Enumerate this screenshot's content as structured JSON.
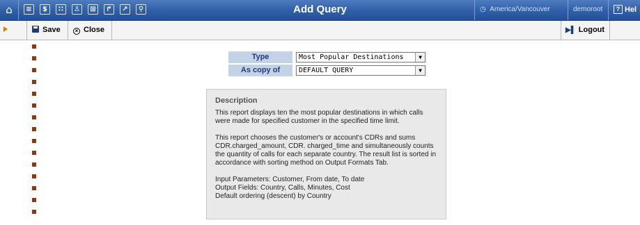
{
  "header": {
    "title": "Add Query",
    "timezone": "America/Vancouver",
    "user": "demoroot",
    "help_label": "Hel",
    "icons": [
      "home-icon",
      "list-icon",
      "dollar-icon",
      "grid-icon",
      "person-icon",
      "tree-icon",
      "arrow-icon",
      "chart-icon",
      "search-icon"
    ]
  },
  "toolbar": {
    "save_label": "Save",
    "close_label": "Close",
    "logout_label": "Logout"
  },
  "form": {
    "type_label": "Type",
    "type_value": "Most Popular Destinations",
    "copy_label": "As copy of",
    "copy_value": "DEFAULT QUERY"
  },
  "description": {
    "heading": "Description",
    "p1": "This report displays ten the most popular destinations in which calls were made for specified customer in the specified time limit.",
    "p2": "This report chooses the customer's or account's CDRs and sums CDR.charged_amount, CDR. charged_time and simultaneously counts the quantity of calls for each separate country. The result list is sorted in accordance with sorting method on Output Formats Tab.",
    "p3_line1": "Input Parameters: Customer, From date, To date",
    "p3_line2": "Output Fields: Country, Calls, Minutes, Cost",
    "p3_line3": "Default ordering (descent) by Country"
  }
}
